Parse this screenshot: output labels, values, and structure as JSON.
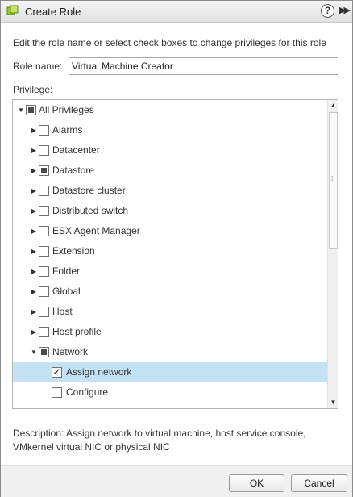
{
  "window": {
    "title": "Create Role",
    "help_glyph": "?",
    "expand_glyph": "▶▶",
    "accent_color": "#c3e2f6"
  },
  "form": {
    "instructions": "Edit the role name or select check boxes to change privileges for this role",
    "role_name_label": "Role name:",
    "role_name_value": "Virtual Machine Creator",
    "privilege_label": "Privilege:"
  },
  "tree": {
    "items": [
      {
        "label": "All Privileges",
        "level": 0,
        "expanded": true,
        "state": "partial"
      },
      {
        "label": "Alarms",
        "level": 1,
        "expanded": false,
        "state": "unchecked"
      },
      {
        "label": "Datacenter",
        "level": 1,
        "expanded": false,
        "state": "unchecked"
      },
      {
        "label": "Datastore",
        "level": 1,
        "expanded": false,
        "state": "partial"
      },
      {
        "label": "Datastore cluster",
        "level": 1,
        "expanded": false,
        "state": "unchecked"
      },
      {
        "label": "Distributed switch",
        "level": 1,
        "expanded": false,
        "state": "unchecked"
      },
      {
        "label": "ESX Agent Manager",
        "level": 1,
        "expanded": false,
        "state": "unchecked"
      },
      {
        "label": "Extension",
        "level": 1,
        "expanded": false,
        "state": "unchecked"
      },
      {
        "label": "Folder",
        "level": 1,
        "expanded": false,
        "state": "unchecked"
      },
      {
        "label": "Global",
        "level": 1,
        "expanded": false,
        "state": "unchecked"
      },
      {
        "label": "Host",
        "level": 1,
        "expanded": false,
        "state": "unchecked"
      },
      {
        "label": "Host profile",
        "level": 1,
        "expanded": false,
        "state": "unchecked"
      },
      {
        "label": "Network",
        "level": 1,
        "expanded": true,
        "state": "partial"
      },
      {
        "label": "Assign network",
        "level": 2,
        "leaf": true,
        "state": "checked",
        "selected": true
      },
      {
        "label": "Configure",
        "level": 2,
        "leaf": true,
        "state": "unchecked"
      }
    ]
  },
  "description": {
    "text": "Description:  Assign network to virtual machine, host service console, VMkernel virtual NIC or physical NIC"
  },
  "footer": {
    "ok_label": "OK",
    "cancel_label": "Cancel"
  }
}
